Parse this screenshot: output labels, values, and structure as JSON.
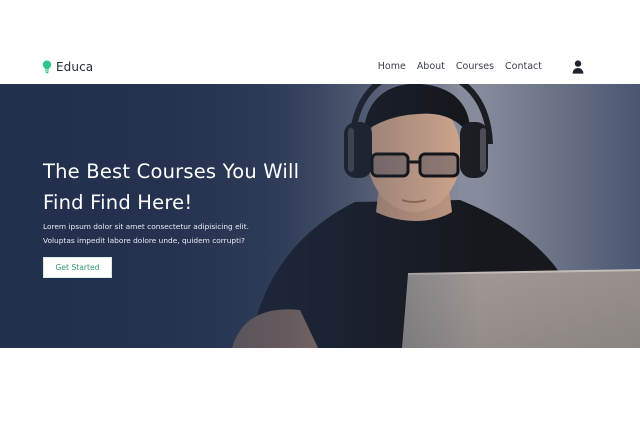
{
  "header": {
    "brand": {
      "name": "Educa",
      "icon": "lightbulb-icon",
      "icon_color": "#2fc48a"
    },
    "nav": [
      {
        "label": "Home"
      },
      {
        "label": "About"
      },
      {
        "label": "Courses"
      },
      {
        "label": "Contact"
      }
    ],
    "user_icon": "user-icon"
  },
  "hero": {
    "title": "The Best Courses You Will Find Find Here!",
    "description": "Lorem ipsum dolor sit amet consectetur adipisicing elit. Voluptas impedit labore dolore unde, quidem corrupti?",
    "cta_label": "Get Started",
    "cta_color": "#2d9a6e",
    "overlay_color": "#22304d"
  }
}
